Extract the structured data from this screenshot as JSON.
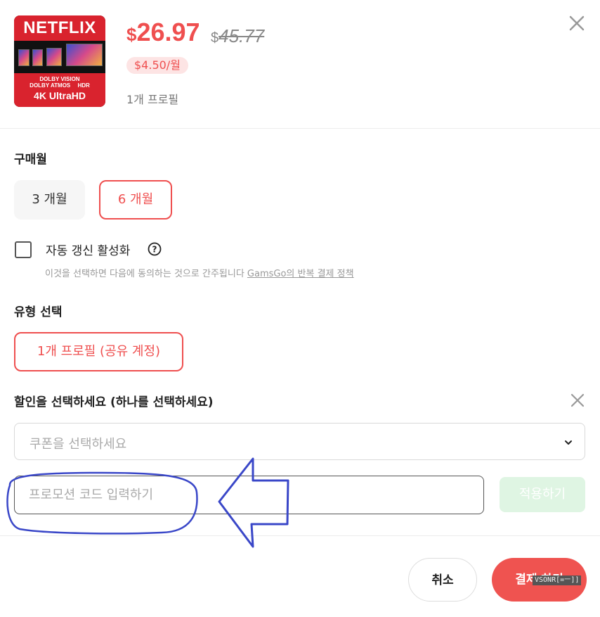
{
  "product": {
    "image": {
      "brand": "NETFLIX",
      "features": [
        "DOLBY VISION",
        "DOLBY ATMOS",
        "HDR"
      ],
      "resolution": "4K UltraHD"
    },
    "price_currency": "$",
    "price": "26.97",
    "old_price_currency": "$",
    "old_price": "45.77",
    "monthly": "$4.50/월",
    "profiles": "1개 프로필"
  },
  "purchase_period": {
    "title": "구매월",
    "options": [
      {
        "label": "3 개월",
        "selected": false
      },
      {
        "label": "6 개월",
        "selected": true
      }
    ]
  },
  "auto_renew": {
    "label": "자동 갱신 활성화",
    "checked": false,
    "consent_text": "이것을 선택하면 다음에 동의하는 것으로 간주됩니다 ",
    "policy_link": "GamsGo의 반복 결제 정책"
  },
  "type_select": {
    "title": "유형 선택",
    "option": "1개 프로필 (공유 계정)"
  },
  "discount": {
    "title": "할인을 선택하세요 (하나를 선택하세요)",
    "coupon_placeholder": "쿠폰을 선택하세요",
    "promo_placeholder": "프로모션 코드 입력하기",
    "promo_value": "",
    "apply_label": "적용하기"
  },
  "footer": {
    "cancel_label": "취소",
    "pay_label": "결제 하기"
  },
  "watermark": "VSONR[=ㅡ]]",
  "colors": {
    "accent": "#ef4f4f",
    "apply_disabled_bg": "#dff5e3",
    "annotation": "#3a47c8"
  }
}
